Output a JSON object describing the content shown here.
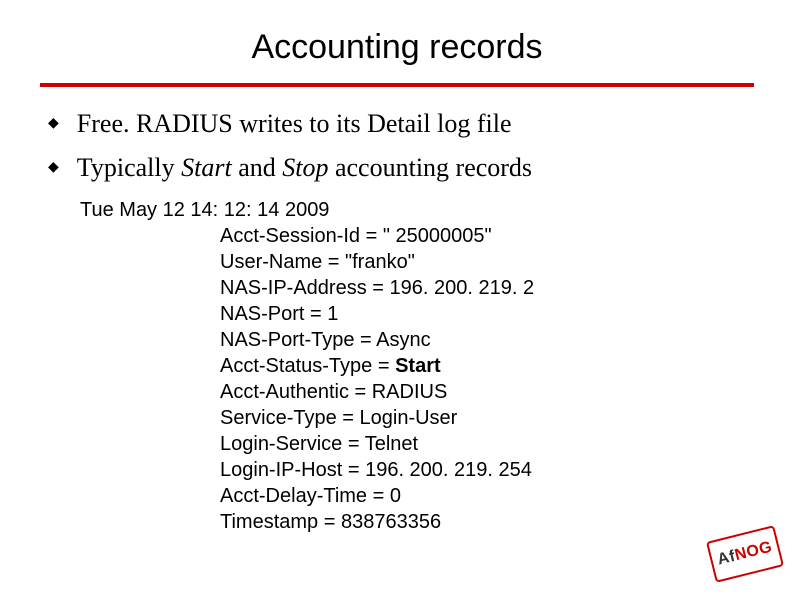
{
  "title": "Accounting records",
  "bullets": [
    {
      "text": "Free. RADIUS writes to its Detail log file"
    }
  ],
  "bullet2": {
    "pre": "Typically ",
    "start": "Start",
    "mid": " and ",
    "stop": "Stop",
    "post": " accounting records"
  },
  "record": {
    "header": "Tue May 12 14: 12: 14 2009",
    "lines": [
      "Acct-Session-Id = \" 25000005\"",
      "User-Name = \"franko\"",
      "NAS-IP-Address = 196. 200. 219. 2",
      "NAS-Port = 1",
      "NAS-Port-Type = Async"
    ],
    "status_prefix": "Acct-Status-Type = ",
    "status_value": "Start",
    "lines2": [
      "Acct-Authentic = RADIUS",
      "Service-Type = Login-User",
      "Login-Service = Telnet",
      "Login-IP-Host = 196. 200. 219. 254",
      "Acct-Delay-Time = 0",
      "Timestamp = 838763356"
    ]
  },
  "stamp": {
    "af": "Af",
    "nog": "NOG"
  }
}
